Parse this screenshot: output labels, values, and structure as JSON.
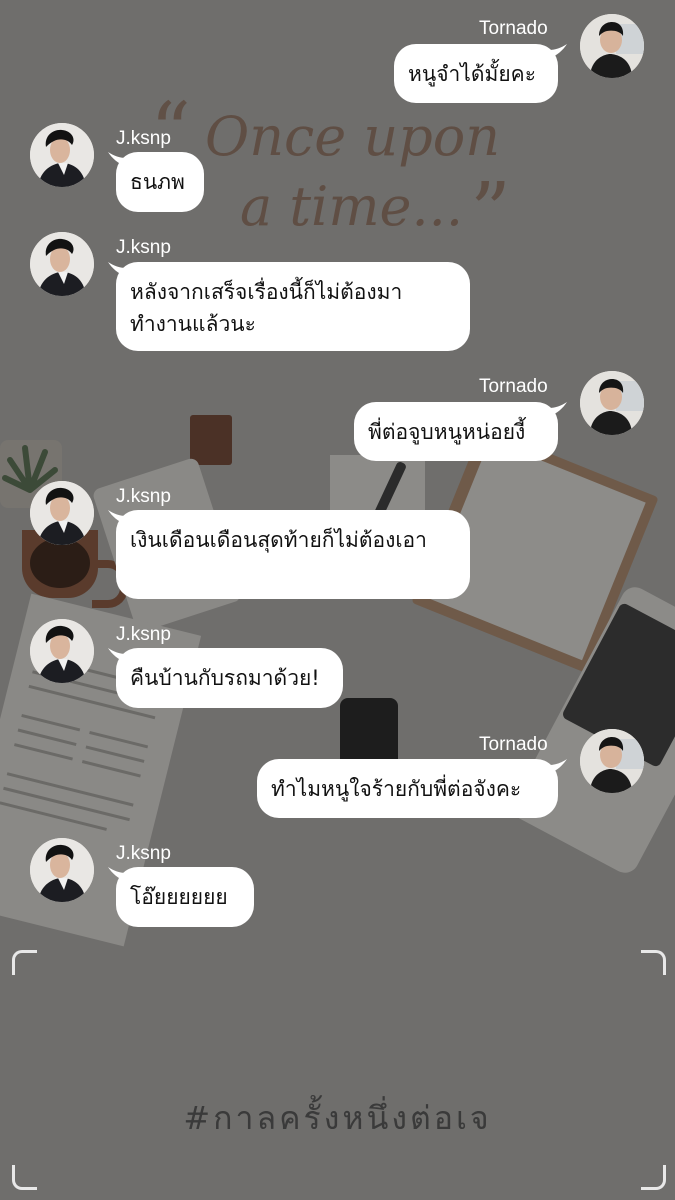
{
  "background": {
    "quote_text_line1": "Once upon",
    "quote_text_line2": "a time...",
    "quote_open_mark": "“",
    "quote_close_mark": "”"
  },
  "messages": [
    {
      "sender": "Tornado",
      "side": "right",
      "text": "หนูจำได้มั้ยคะ"
    },
    {
      "sender": "J.ksnp",
      "side": "left",
      "text": "ธนภพ"
    },
    {
      "sender": "J.ksnp",
      "side": "left",
      "text": "หลังจากเสร็จเรื่องนี้ก็ไม่ต้องมาทำงานแล้วนะ"
    },
    {
      "sender": "Tornado",
      "side": "right",
      "text": "พี่ต่อจูบหนูหน่อยงี้"
    },
    {
      "sender": "J.ksnp",
      "side": "left",
      "text": "เงินเดือนเดือนสุดท้ายก็ไม่ต้องเอา"
    },
    {
      "sender": "J.ksnp",
      "side": "left",
      "text": "คืนบ้านกับรถมาด้วย!"
    },
    {
      "sender": "Tornado",
      "side": "right",
      "text": "ทำไมหนูใจร้ายกับพี่ต่อจังคะ"
    },
    {
      "sender": "J.ksnp",
      "side": "left",
      "text": "โอ๊ยยยยยย"
    }
  ],
  "footer": {
    "hashtag": "#กาลครั้งหนึ่งต่อเจ"
  },
  "colors": {
    "overlay": "#6f6e6c",
    "bubble": "#ffffff",
    "name_text": "#ffffff",
    "hashtag_text": "#3a3a3a"
  }
}
